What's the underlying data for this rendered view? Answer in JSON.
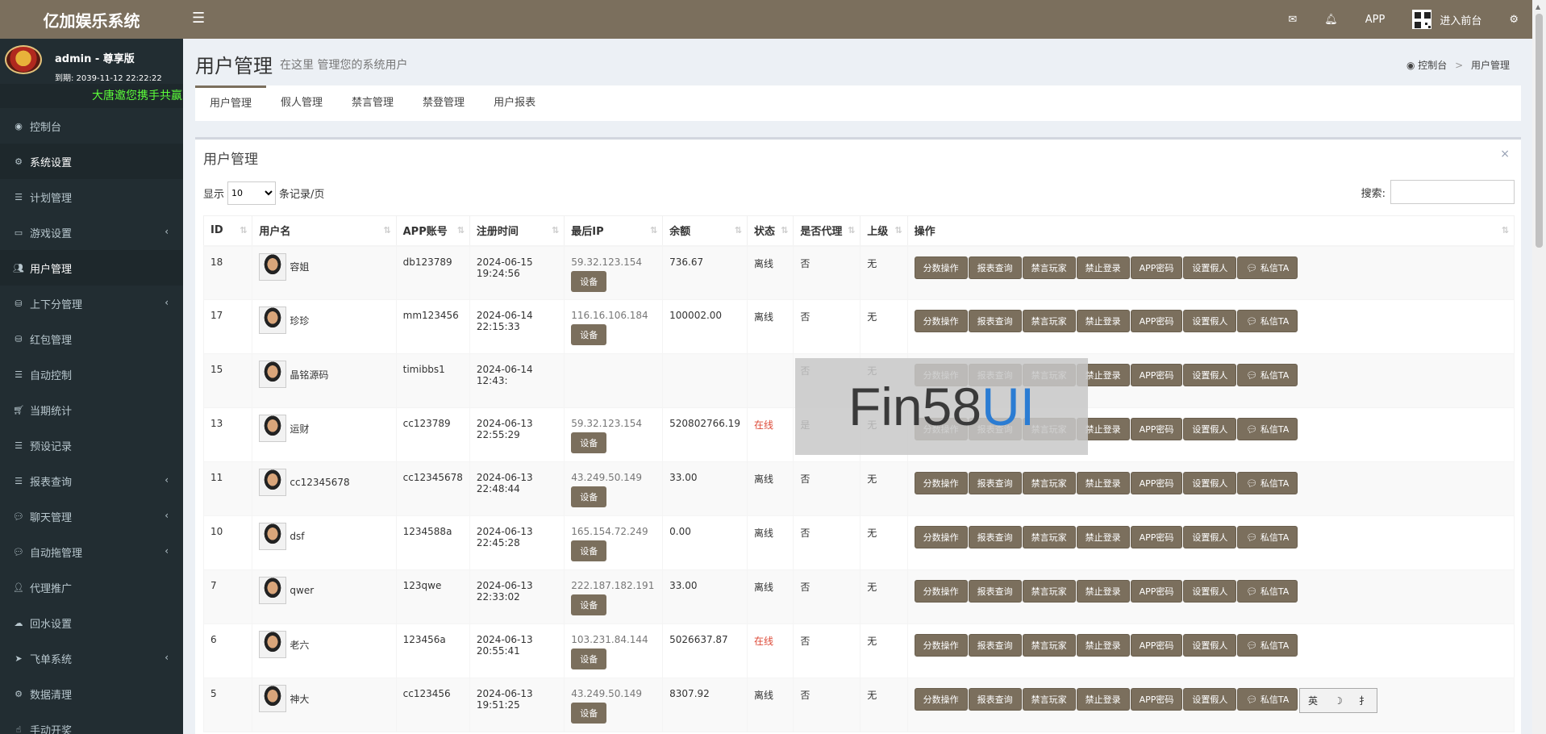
{
  "app": {
    "brand": "亿加娱乐系统",
    "menu_icon": "bars-icon",
    "top_nav": {
      "mail_icon": "envelope-icon",
      "bell_icon": "bell-icon",
      "app_label": "APP",
      "enter_front": "进入前台",
      "settings_icon": "gears-icon"
    }
  },
  "user_panel": {
    "name": "admin - 尊享版",
    "expire": "到期: 2039-11-12 22:22:22",
    "marquee": "大唐邀您携手共赢"
  },
  "sidebar": {
    "items": [
      {
        "label": "控制台",
        "icon": "dashboard-icon",
        "chevron": ""
      },
      {
        "label": "系统设置",
        "icon": "gears-icon",
        "chevron": ""
      },
      {
        "label": "计划管理",
        "icon": "list-icon",
        "chevron": ""
      },
      {
        "label": "游戏设置",
        "icon": "gamepad-icon",
        "chevron": "‹"
      },
      {
        "label": "用户管理",
        "icon": "users-icon",
        "chevron": ""
      },
      {
        "label": "上下分管理",
        "icon": "database-icon",
        "chevron": "‹"
      },
      {
        "label": "红包管理",
        "icon": "database-icon",
        "chevron": ""
      },
      {
        "label": "自动控制",
        "icon": "list-icon",
        "chevron": ""
      },
      {
        "label": "当期统计",
        "icon": "cart-icon",
        "chevron": ""
      },
      {
        "label": "预设记录",
        "icon": "list-icon",
        "chevron": ""
      },
      {
        "label": "报表查询",
        "icon": "list-icon",
        "chevron": "‹"
      },
      {
        "label": "聊天管理",
        "icon": "comments-icon",
        "chevron": "‹"
      },
      {
        "label": "自动拖管理",
        "icon": "comment-icon",
        "chevron": "‹"
      },
      {
        "label": "代理推广",
        "icon": "user-plus-icon",
        "chevron": ""
      },
      {
        "label": "回水设置",
        "icon": "cloud-download-icon",
        "chevron": ""
      },
      {
        "label": "飞单系统",
        "icon": "paper-plane-icon",
        "chevron": "‹"
      },
      {
        "label": "数据清理",
        "icon": "gear-icon",
        "chevron": ""
      },
      {
        "label": "手动开奖",
        "icon": "hand-icon",
        "chevron": ""
      }
    ]
  },
  "header": {
    "title": "用户管理",
    "subtitle": "在这里 管理您的系统用户",
    "breadcrumb_home": "控制台",
    "breadcrumb_sep": ">",
    "breadcrumb_current": "用户管理"
  },
  "tabs": [
    "用户管理",
    "假人管理",
    "禁言管理",
    "禁登管理",
    "用户报表"
  ],
  "box": {
    "title": "用户管理",
    "close": "×",
    "show_label": "显示",
    "page_size": "10",
    "per_page_label": "条记录/页",
    "search_label": "搜索:",
    "search_value": ""
  },
  "table": {
    "columns": [
      "ID",
      "用户名",
      "APP账号",
      "注册时间",
      "最后IP",
      "余额",
      "状态",
      "是否代理",
      "上级",
      "操作"
    ],
    "device_button": "设备",
    "actions": [
      "分数操作",
      "报表查询",
      "禁言玩家",
      "禁止登录",
      "APP密码",
      "设置假人",
      "私信TA"
    ],
    "rows": [
      {
        "id": "18",
        "name": "容姐",
        "app": "db123789",
        "reg": "2024-06-15 19:24:56",
        "ip": "59.32.123.154",
        "balance": "736.67",
        "status": "离线",
        "online": false,
        "agent": "否",
        "parent": "无"
      },
      {
        "id": "17",
        "name": "珍珍",
        "app": "mm123456",
        "reg": "2024-06-14 22:15:33",
        "ip": "116.16.106.184",
        "balance": "100002.00",
        "status": "离线",
        "online": false,
        "agent": "否",
        "parent": "无"
      },
      {
        "id": "15",
        "name": "晶铭源码",
        "app": "timibbs1",
        "reg": "2024-06-14 12:43:",
        "ip": "",
        "balance": "",
        "status": "",
        "online": false,
        "agent": "否",
        "parent": "无"
      },
      {
        "id": "13",
        "name": "运财",
        "app": "cc123789",
        "reg": "2024-06-13 22:55:29",
        "ip": "59.32.123.154",
        "balance": "520802766.19",
        "status": "在线",
        "online": true,
        "agent": "是",
        "parent": "无"
      },
      {
        "id": "11",
        "name": "cc12345678",
        "app": "cc12345678",
        "reg": "2024-06-13 22:48:44",
        "ip": "43.249.50.149",
        "balance": "33.00",
        "status": "离线",
        "online": false,
        "agent": "否",
        "parent": "无"
      },
      {
        "id": "10",
        "name": "dsf",
        "app": "1234588a",
        "reg": "2024-06-13 22:45:28",
        "ip": "165.154.72.249",
        "balance": "0.00",
        "status": "离线",
        "online": false,
        "agent": "否",
        "parent": "无"
      },
      {
        "id": "7",
        "name": "qwer",
        "app": "123qwe",
        "reg": "2024-06-13 22:33:02",
        "ip": "222.187.182.191",
        "balance": "33.00",
        "status": "离线",
        "online": false,
        "agent": "否",
        "parent": "无"
      },
      {
        "id": "6",
        "name": "老六",
        "app": "123456a",
        "reg": "2024-06-13 20:55:41",
        "ip": "103.231.84.144",
        "balance": "5026637.87",
        "status": "在线",
        "online": true,
        "agent": "否",
        "parent": "无"
      },
      {
        "id": "5",
        "name": "神大",
        "app": "cc123456",
        "reg": "2024-06-13 19:51:25",
        "ip": "43.249.50.149",
        "balance": "8307.92",
        "status": "离线",
        "online": false,
        "agent": "否",
        "parent": "无"
      }
    ]
  },
  "watermark": {
    "part1": "Fin58",
    "part2": "UI"
  },
  "ime": {
    "lang": "英",
    "moon": "☽",
    "mode": "⺘"
  },
  "colors": {
    "accent": "#7b6f5d",
    "sidebar": "#222d32",
    "online": "#dd4b39",
    "marquee": "#5cff3a"
  }
}
